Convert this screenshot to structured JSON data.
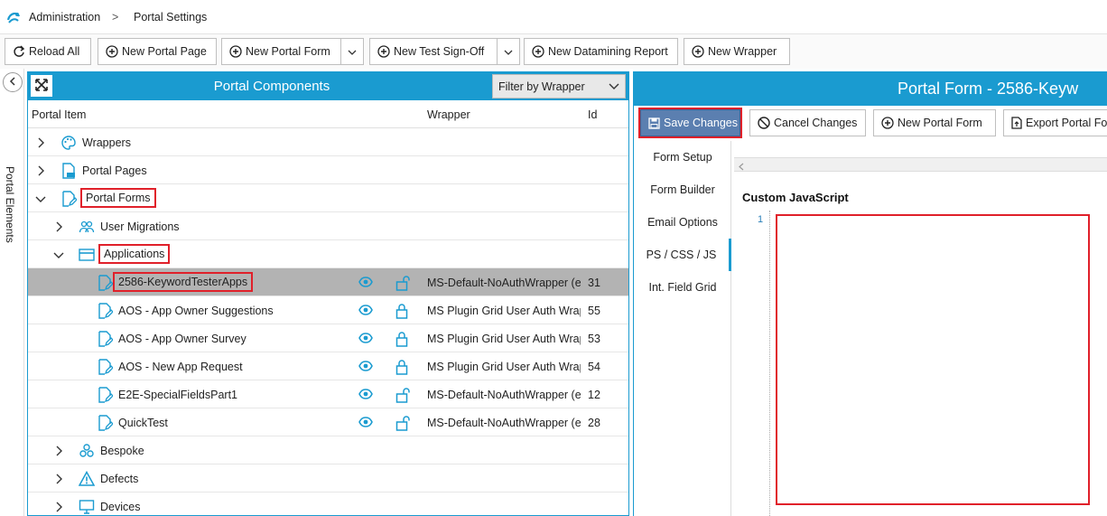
{
  "breadcrumb": {
    "root": "Administration",
    "separator": ">",
    "current": "Portal Settings"
  },
  "toolbar": {
    "reload_all": "Reload All",
    "new_portal_page": "New Portal Page",
    "new_portal_form": "New Portal Form",
    "new_test_signoff": "New Test Sign-Off",
    "new_datamining_report": "New Datamining Report",
    "new_wrapper": "New Wrapper"
  },
  "side_tab": {
    "label": "Portal Elements"
  },
  "components": {
    "title": "Portal Components",
    "filter_label": "Filter by Wrapper",
    "columns": {
      "item": "Portal Item",
      "wrapper": "Wrapper",
      "id": "Id"
    },
    "rows": [
      {
        "label": "Wrappers",
        "level": 0,
        "expanded": false,
        "icon": "palette-icon"
      },
      {
        "label": "Portal Pages",
        "level": 0,
        "expanded": false,
        "icon": "page-icon"
      },
      {
        "label": "Portal Forms",
        "level": 0,
        "expanded": true,
        "icon": "form-icon"
      },
      {
        "label": "User Migrations",
        "level": 1,
        "expanded": false,
        "icon": "users-icon"
      },
      {
        "label": "Applications",
        "level": 1,
        "expanded": true,
        "icon": "window-icon"
      },
      {
        "label": "2586-KeywordTesterApps",
        "level": 2,
        "wrapper": "MS-Default-NoAuthWrapper (er",
        "id": "31",
        "locked": false,
        "selected": true
      },
      {
        "label": "AOS - App Owner Suggestions",
        "level": 2,
        "wrapper": "MS Plugin Grid User Auth Wrapp",
        "id": "55",
        "locked": true
      },
      {
        "label": "AOS - App Owner Survey",
        "level": 2,
        "wrapper": "MS Plugin Grid User Auth Wrapp",
        "id": "53",
        "locked": true
      },
      {
        "label": "AOS - New App Request",
        "level": 2,
        "wrapper": "MS Plugin Grid User Auth Wrapp",
        "id": "54",
        "locked": true
      },
      {
        "label": "E2E-SpecialFieldsPart1",
        "level": 2,
        "wrapper": "MS-Default-NoAuthWrapper (er",
        "id": "12",
        "locked": false
      },
      {
        "label": "QuickTest",
        "level": 2,
        "wrapper": "MS-Default-NoAuthWrapper (er",
        "id": "28",
        "locked": false
      },
      {
        "label": "Bespoke",
        "level": 1,
        "expanded": false,
        "icon": "bespoke-icon"
      },
      {
        "label": "Defects",
        "level": 1,
        "expanded": false,
        "icon": "warning-icon"
      },
      {
        "label": "Devices",
        "level": 1,
        "expanded": false,
        "icon": "monitor-icon"
      }
    ]
  },
  "form_panel": {
    "title": "Portal Form -  2586-Keyw",
    "save_changes": "Save Changes",
    "cancel_changes": "Cancel Changes",
    "new_portal_form": "New Portal Form",
    "export_portal_form": "Export Portal Form",
    "tabs": [
      "Form Setup",
      "Form Builder",
      "Email Options",
      "PS / CSS / JS",
      "Int. Field Grid"
    ],
    "active_tab": "PS / CSS / JS",
    "section_label": "Custom JavaScript",
    "line_number": "1"
  },
  "colors": {
    "accent": "#1a9bd0",
    "selected_row": "#b3b3b3",
    "highlight": "#e0202a",
    "save_button": "#5b7fb0"
  }
}
